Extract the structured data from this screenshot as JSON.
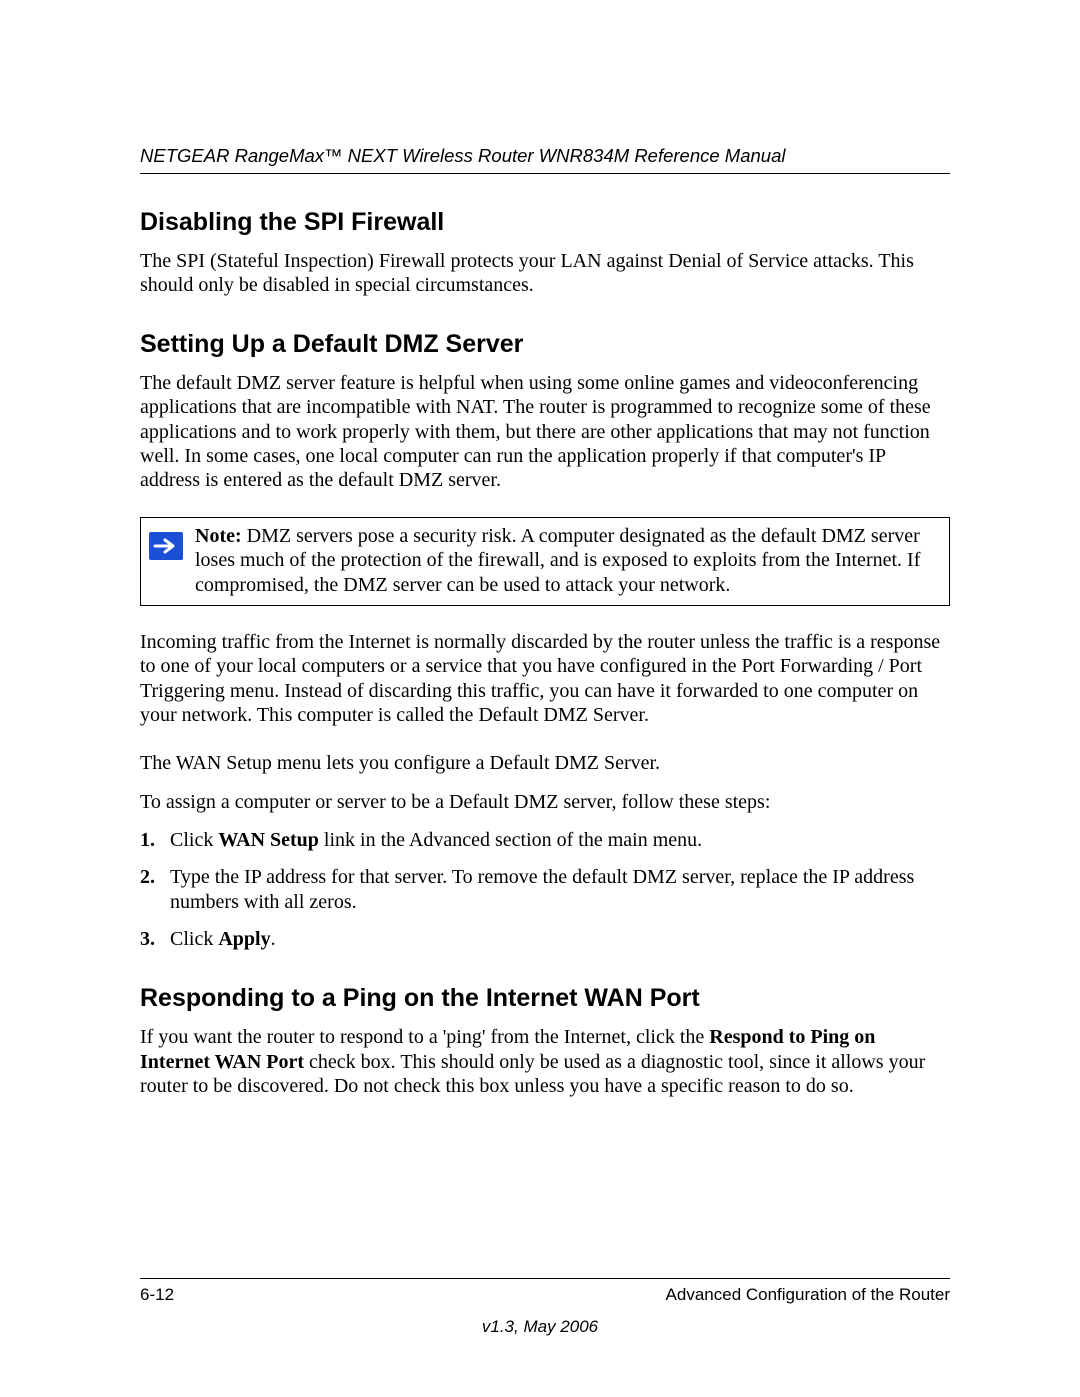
{
  "header": {
    "running_title": "NETGEAR RangeMax™ NEXT Wireless Router WNR834M Reference Manual"
  },
  "sections": {
    "spi": {
      "heading": "Disabling the SPI Firewall",
      "body": "The SPI (Stateful Inspection) Firewall protects your LAN against Denial of Service attacks. This should only be disabled in special circumstances."
    },
    "dmz": {
      "heading": "Setting Up a Default DMZ Server",
      "intro": "The default DMZ server feature is helpful when using some online games and videoconferencing applications that are incompatible with NAT. The router is programmed to recognize some of these applications and to work properly with them, but there are other applications that may not function well. In some cases, one local computer can run the application properly if that computer's IP address is entered as the default DMZ server.",
      "note_label": "Note:",
      "note_body": " DMZ servers pose a security risk. A computer designated as the default DMZ server loses much of the protection of the firewall, and is exposed to exploits from the Internet. If compromised, the DMZ server can be used to attack your network.",
      "p_after_note": "Incoming traffic from the Internet is normally discarded by the router unless the traffic is a response to one of your local computers or a service that you have configured in the Port Forwarding / Port Triggering menu. Instead of discarding this traffic, you can have it forwarded to one computer on your network. This computer is called the Default DMZ Server.",
      "p_wan_setup": "The WAN Setup menu lets you configure a Default DMZ Server.",
      "p_steps_intro": "To assign a computer or server to be a Default DMZ server, follow these steps:",
      "steps": {
        "s1_a": "Click ",
        "s1_b": "WAN Setup",
        "s1_c": " link in the Advanced section of the main menu.",
        "s2": "Type the IP address for that server. To remove the default DMZ server, replace the IP address numbers with all zeros.",
        "s3_a": "Click ",
        "s3_b": "Apply",
        "s3_c": "."
      }
    },
    "ping": {
      "heading": "Responding to a Ping on the Internet WAN Port",
      "body_a": "If you want the router to respond to a 'ping' from the Internet, click the ",
      "body_b": "Respond to Ping on Internet WAN Port",
      "body_c": " check box. This should only be used as a diagnostic tool, since it allows your router to be discovered. Do not check this box unless you have a specific reason to do so."
    }
  },
  "footer": {
    "page_number": "6-12",
    "section_title": "Advanced Configuration of the Router",
    "version": "v1.3, May 2006"
  }
}
